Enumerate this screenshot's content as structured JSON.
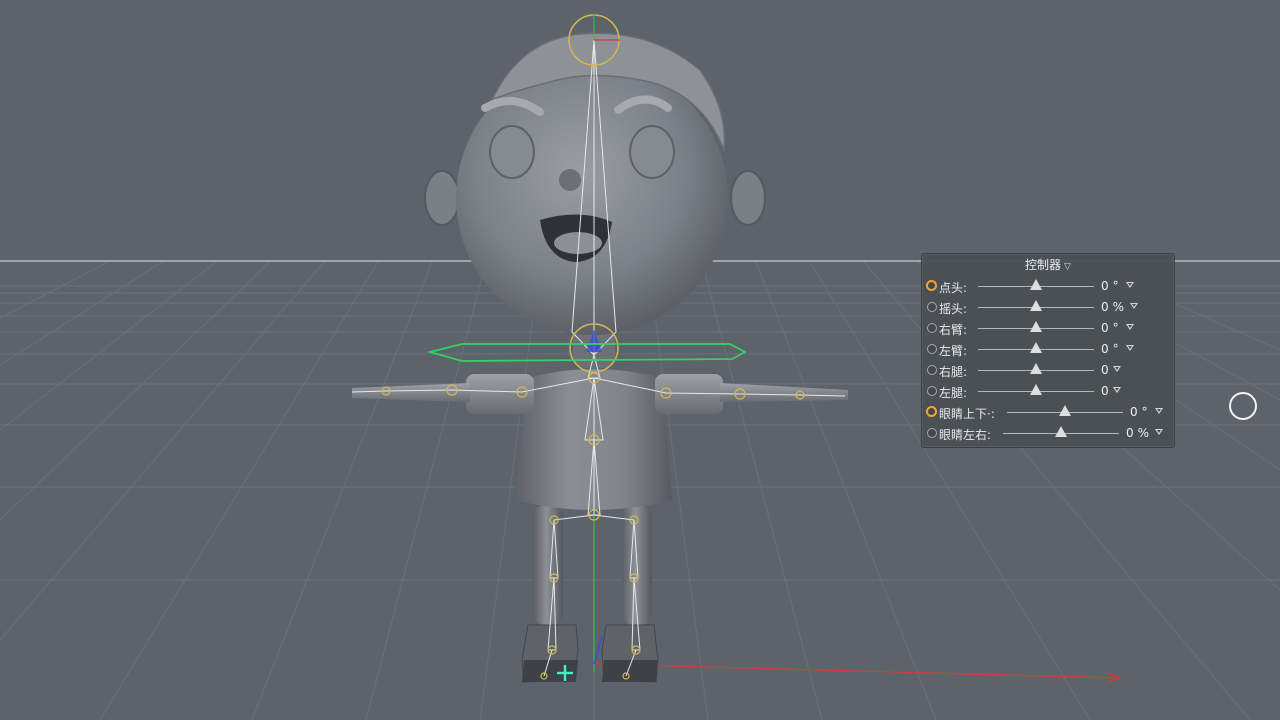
{
  "viewport": {
    "background": "#5d636b",
    "axis_colors": {
      "x": "#d23b3b",
      "y": "#2fbf4a",
      "z": "#3a4fd6"
    },
    "selection_color": "#36d15e",
    "joint_color": "#d4b84a"
  },
  "controller": {
    "title": "控制器",
    "title_icon": "caret-down-icon",
    "rows": [
      {
        "label": "点头:",
        "value": "0",
        "unit": "°",
        "active": true,
        "slider": 0.5
      },
      {
        "label": "摇头:",
        "value": "0",
        "unit": "%",
        "active": false,
        "slider": 0.5
      },
      {
        "label": "右臂:",
        "value": "0",
        "unit": "°",
        "active": false,
        "slider": 0.5
      },
      {
        "label": "左臂:",
        "value": "0",
        "unit": "°",
        "active": false,
        "slider": 0.5
      },
      {
        "label": "右腿:",
        "value": "0",
        "unit": "",
        "active": false,
        "slider": 0.5
      },
      {
        "label": "左腿:",
        "value": "0",
        "unit": "",
        "active": false,
        "slider": 0.5
      },
      {
        "label": "眼睛上下·:",
        "value": "0",
        "unit": "°",
        "active": true,
        "slider": 0.5
      },
      {
        "label": "眼睛左右:",
        "value": "0",
        "unit": "%",
        "active": false,
        "slider": 0.5
      }
    ]
  },
  "icons": {
    "navigation": "navigation-circle-icon",
    "world_origin": "world-origin-cross-icon"
  }
}
